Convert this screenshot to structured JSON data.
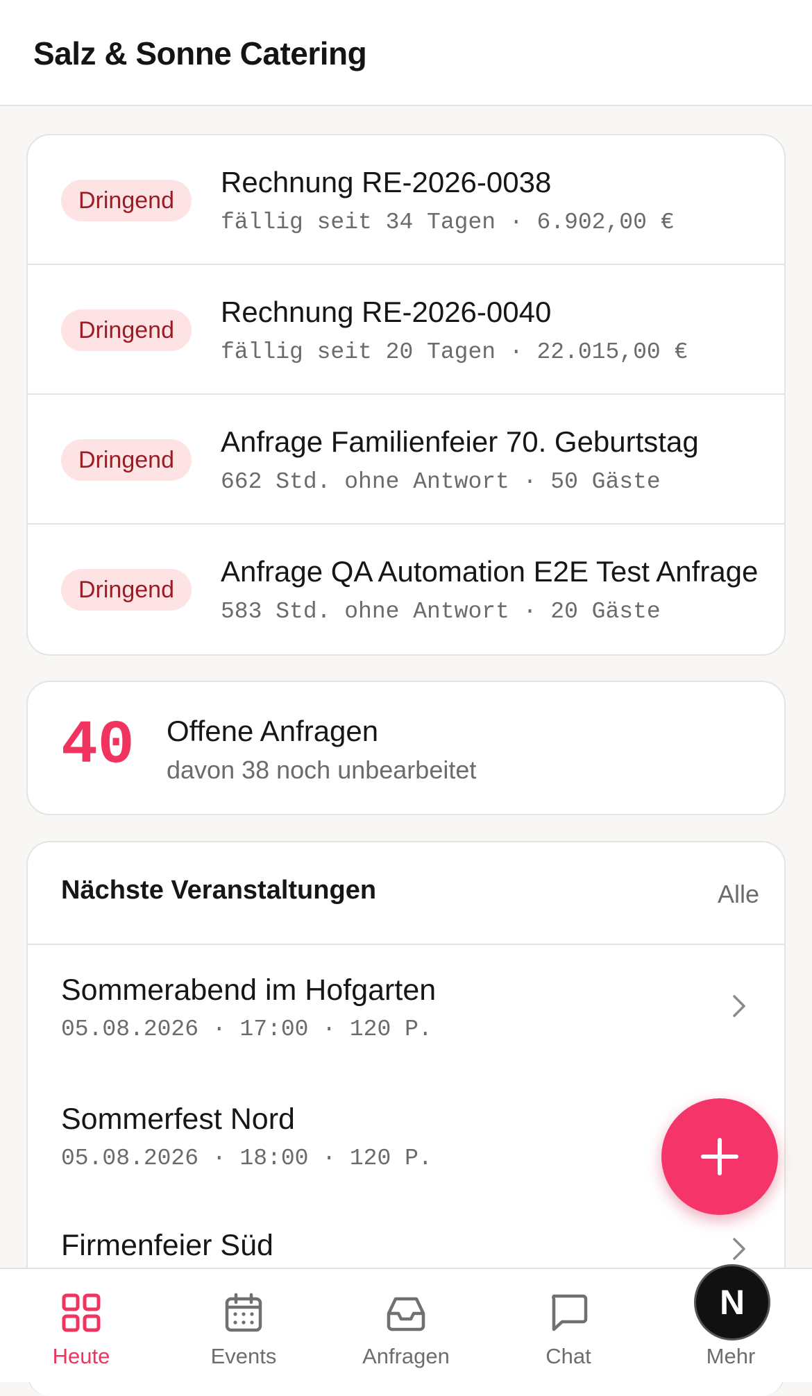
{
  "app": {
    "title": "Salz & Sonne Catering"
  },
  "urgent": {
    "items": [
      {
        "badge": "Dringend",
        "title": "Rechnung RE-2026-0038",
        "subtitle": "fällig seit 34 Tagen · 6.902,00 €"
      },
      {
        "badge": "Dringend",
        "title": "Rechnung RE-2026-0040",
        "subtitle": "fällig seit 20 Tagen · 22.015,00 €"
      },
      {
        "badge": "Dringend",
        "title": "Anfrage Familienfeier 70. Geburtstag",
        "subtitle": "662 Std. ohne Antwort · 50 Gäste"
      },
      {
        "badge": "Dringend",
        "title": "Anfrage QA Automation E2E Test Anfrage",
        "subtitle": "583 Std. ohne Antwort · 20 Gäste"
      }
    ]
  },
  "open_requests": {
    "count": "40",
    "title": "Offene Anfragen",
    "subtitle": "davon 38 noch unbearbeitet"
  },
  "events": {
    "title": "Nächste Veranstaltungen",
    "all_label": "Alle",
    "items": [
      {
        "name": "Sommerabend im Hofgarten",
        "meta": "05.08.2026 · 17:00 · 120 P."
      },
      {
        "name": "Sommerfest Nord",
        "meta": "05.08.2026 · 18:00 · 120 P."
      },
      {
        "name": "Firmenfeier Süd",
        "meta": ""
      }
    ]
  },
  "fab": {
    "icon": "plus-icon"
  },
  "nav": {
    "items": [
      {
        "label": "Heute",
        "icon": "grid-icon",
        "active": true
      },
      {
        "label": "Events",
        "icon": "calendar-icon",
        "active": false
      },
      {
        "label": "Anfragen",
        "icon": "inbox-icon",
        "active": false
      },
      {
        "label": "Chat",
        "icon": "chat-icon",
        "active": false
      },
      {
        "label": "Mehr",
        "icon": "more-icon",
        "active": false
      }
    ]
  },
  "avatar": {
    "initial": "N"
  },
  "colors": {
    "accent": "#f0345f",
    "badge_bg": "#fde3e4",
    "badge_text": "#9c1c26",
    "background": "#f8f7f5"
  }
}
